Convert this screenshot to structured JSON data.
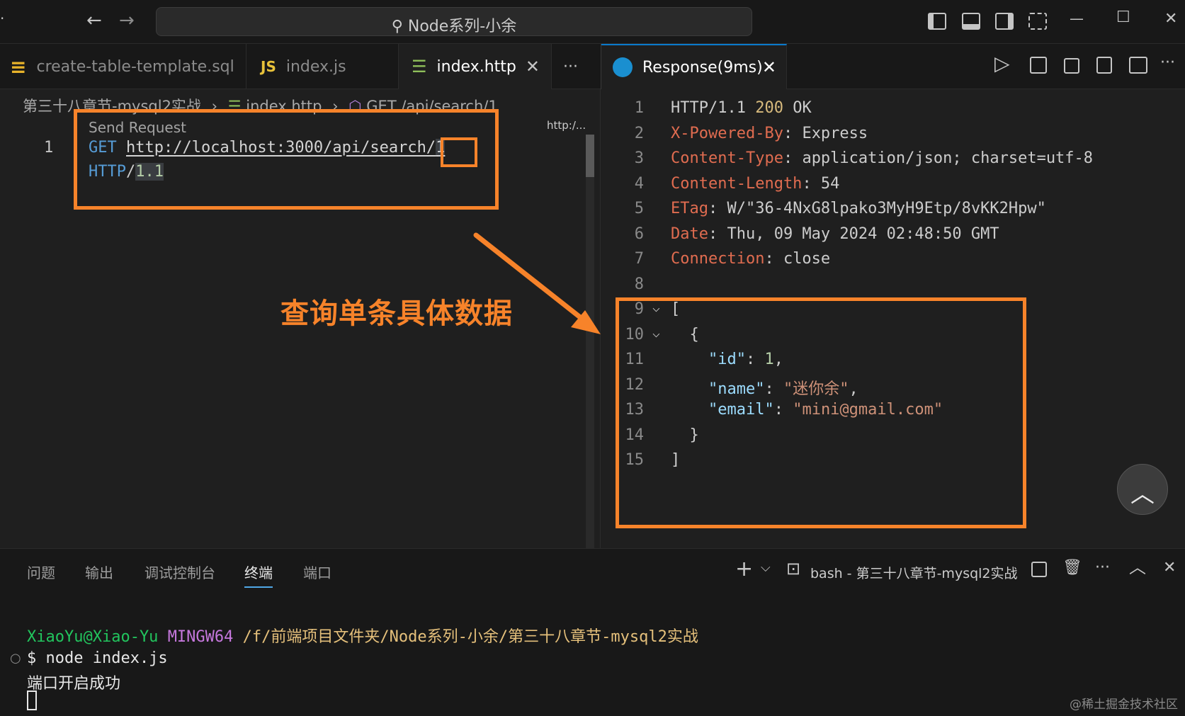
{
  "titlebar": {
    "search_text": "⚲ Node系列-小余",
    "back_icon": "←",
    "forward_icon": "→",
    "minimize": "—",
    "maximize": "☐",
    "close": "✕"
  },
  "tabs": [
    {
      "label": "create-table-template.sql",
      "icon": "database-icon",
      "icon_glyph": "≡"
    },
    {
      "label": "index.js",
      "icon": "js-icon",
      "icon_glyph": "JS"
    },
    {
      "label": "index.http",
      "icon": "http-file-icon",
      "icon_glyph": "☰",
      "close": "✕"
    },
    {
      "label": "···"
    },
    {
      "label": "Response(9ms)",
      "icon": "rest-client-icon",
      "close": "✕"
    }
  ],
  "editor_actions": {
    "run": "▷",
    "more": "···"
  },
  "breadcrumb": {
    "folder": "第三十八章节-mysql2实战",
    "sep": "›",
    "file": "index.http",
    "symbol": "GET /api/search/1"
  },
  "request": {
    "codelens": "Send Request",
    "line_number": "1",
    "method": "GET",
    "url": "http://localhost:3000/api/search/",
    "url_id": "1",
    "protocol": "HTTP",
    "slash": "/",
    "version": "1.1",
    "minimap_label": "http:/..."
  },
  "annotation": {
    "text": "查询单条具体数据"
  },
  "response": {
    "lines": [
      {
        "n": "1",
        "parts": [
          [
            "plain",
            "HTTP/1.1 "
          ],
          [
            "num200",
            "200"
          ],
          [
            "plain",
            " OK"
          ]
        ]
      },
      {
        "n": "2",
        "parts": [
          [
            "key",
            "X-Powered-By"
          ],
          [
            "plain",
            ": Express"
          ]
        ]
      },
      {
        "n": "3",
        "parts": [
          [
            "key",
            "Content-Type"
          ],
          [
            "plain",
            ": application/json; charset=utf-8"
          ]
        ]
      },
      {
        "n": "4",
        "parts": [
          [
            "key",
            "Content-Length"
          ],
          [
            "plain",
            ": 54"
          ]
        ]
      },
      {
        "n": "5",
        "parts": [
          [
            "key",
            "ETag"
          ],
          [
            "plain",
            ": W/\"36-4NxG8lpako3MyH9Etp/8vKK2Hpw\""
          ]
        ]
      },
      {
        "n": "6",
        "parts": [
          [
            "key",
            "Date"
          ],
          [
            "plain",
            ": Thu, 09 May 2024 02:48:50 GMT"
          ]
        ]
      },
      {
        "n": "7",
        "parts": [
          [
            "key",
            "Connection"
          ],
          [
            "plain",
            ": close"
          ]
        ]
      },
      {
        "n": "8",
        "parts": []
      },
      {
        "n": "9",
        "fold": "⌵",
        "parts": [
          [
            "plain",
            "["
          ]
        ]
      },
      {
        "n": "10",
        "fold": "⌵",
        "parts": [
          [
            "plain",
            "  {"
          ]
        ]
      },
      {
        "n": "11",
        "parts": [
          [
            "plain",
            "    "
          ],
          [
            "jkey",
            "\"id\""
          ],
          [
            "plain",
            ": "
          ],
          [
            "jnum",
            "1"
          ],
          [
            "plain",
            ","
          ]
        ]
      },
      {
        "n": "12",
        "parts": [
          [
            "plain",
            "    "
          ],
          [
            "jkey",
            "\"name\""
          ],
          [
            "plain",
            ": "
          ],
          [
            "jstr",
            "\"迷你余\""
          ],
          [
            "plain",
            ","
          ]
        ]
      },
      {
        "n": "13",
        "parts": [
          [
            "plain",
            "    "
          ],
          [
            "jkey",
            "\"email\""
          ],
          [
            "plain",
            ": "
          ],
          [
            "jstr",
            "\"mini@gmail.com\""
          ]
        ]
      },
      {
        "n": "14",
        "parts": [
          [
            "plain",
            "  }"
          ]
        ]
      },
      {
        "n": "15",
        "parts": [
          [
            "plain",
            "]"
          ]
        ]
      }
    ],
    "scroll_top_icon": "︿"
  },
  "bottom_panel": {
    "tabs": [
      "问题",
      "输出",
      "调试控制台",
      "终端",
      "端口"
    ],
    "active_tab": "终端",
    "terminal_name": "bash - 第三十八章节-mysql2实战",
    "add_icon": "+",
    "dropdown_icon": "⌵",
    "terminal_icon": "⊡",
    "trash_icon": "🗑",
    "more_icon": "···",
    "collapse_icon": "︿",
    "close_icon": "✕"
  },
  "terminal": {
    "user": "XiaoYu@Xiao-Yu",
    "env": "MINGW64",
    "path": "/f/前端项目文件夹/Node系列-小余/第三十八章节-mysql2实战",
    "prompt_marker": "○",
    "command": "$ node index.js",
    "output": "端口开启成功"
  },
  "watermark": "@稀土掘金技术社区",
  "colors": {
    "accent_orange": "#f7832a",
    "background": "#1f1f1f"
  }
}
